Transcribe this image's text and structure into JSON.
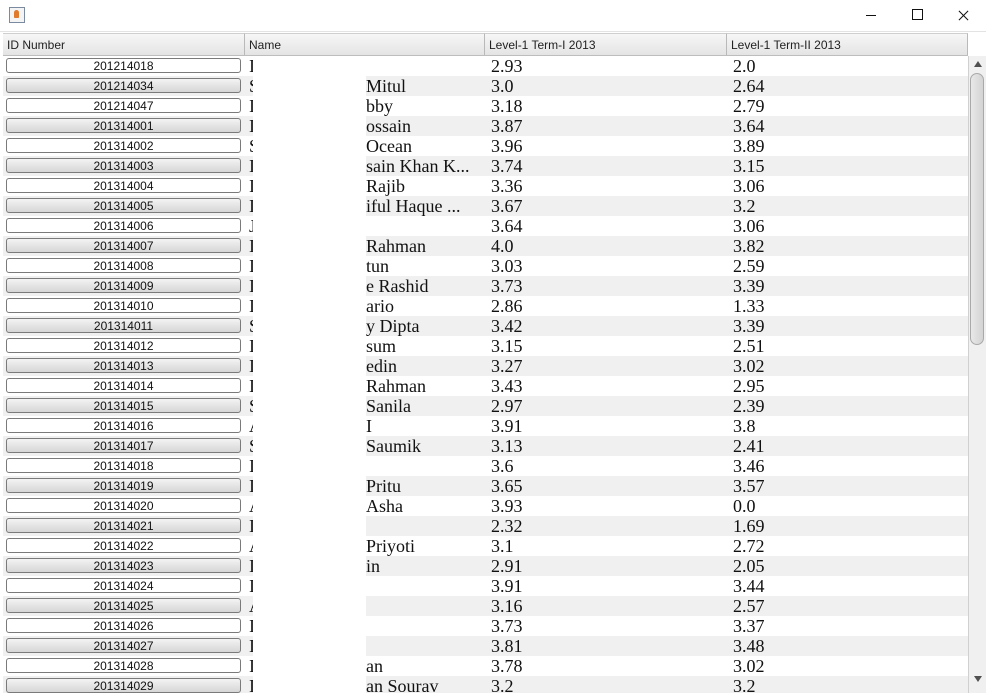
{
  "window": {
    "app_icon": "java-cup-icon",
    "controls": [
      "minimize-icon",
      "maximize-icon",
      "close-icon"
    ]
  },
  "table": {
    "headers": [
      "ID Number",
      "Name",
      "Level-1 Term-I 2013",
      "Level-1 Term-II 2013"
    ],
    "rows": [
      {
        "id": "201214018",
        "name_lead": "I",
        "name_tail": "",
        "t1": "2.93",
        "t2": "2.0"
      },
      {
        "id": "201214034",
        "name_lead": "S",
        "name_tail": "Mitul",
        "t1": "3.0",
        "t2": "2.64"
      },
      {
        "id": "201214047",
        "name_lead": "I",
        "name_tail": "bby",
        "t1": "3.18",
        "t2": "2.79"
      },
      {
        "id": "201314001",
        "name_lead": "I",
        "name_tail": "ossain",
        "t1": "3.87",
        "t2": "3.64"
      },
      {
        "id": "201314002",
        "name_lead": "S",
        "name_tail": "Ocean",
        "t1": "3.96",
        "t2": "3.89"
      },
      {
        "id": "201314003",
        "name_lead": "I",
        "name_tail": "sain Khan K...",
        "t1": "3.74",
        "t2": "3.15"
      },
      {
        "id": "201314004",
        "name_lead": "I",
        "name_tail": "Rajib",
        "t1": "3.36",
        "t2": "3.06"
      },
      {
        "id": "201314005",
        "name_lead": "I",
        "name_tail": "iful Haque ...",
        "t1": "3.67",
        "t2": "3.2"
      },
      {
        "id": "201314006",
        "name_lead": "J",
        "name_tail": "",
        "t1": "3.64",
        "t2": "3.06"
      },
      {
        "id": "201314007",
        "name_lead": "I",
        "name_tail": "Rahman",
        "t1": "4.0",
        "t2": "3.82"
      },
      {
        "id": "201314008",
        "name_lead": "I",
        "name_tail": "tun",
        "t1": "3.03",
        "t2": "2.59"
      },
      {
        "id": "201314009",
        "name_lead": "I",
        "name_tail": "e Rashid",
        "t1": "3.73",
        "t2": "3.39"
      },
      {
        "id": "201314010",
        "name_lead": "I",
        "name_tail": "ario",
        "t1": "2.86",
        "t2": "1.33"
      },
      {
        "id": "201314011",
        "name_lead": "S",
        "name_tail": "y Dipta",
        "t1": "3.42",
        "t2": "3.39"
      },
      {
        "id": "201314012",
        "name_lead": "I",
        "name_tail": "sum",
        "t1": "3.15",
        "t2": "2.51"
      },
      {
        "id": "201314013",
        "name_lead": "I",
        "name_tail": "edin",
        "t1": "3.27",
        "t2": "3.02"
      },
      {
        "id": "201314014",
        "name_lead": "I",
        "name_tail": "Rahman",
        "t1": "3.43",
        "t2": "2.95"
      },
      {
        "id": "201314015",
        "name_lead": "S",
        "name_tail": "Sanila",
        "t1": "2.97",
        "t2": "2.39"
      },
      {
        "id": "201314016",
        "name_lead": "A",
        "name_tail": "I",
        "t1": "3.91",
        "t2": "3.8"
      },
      {
        "id": "201314017",
        "name_lead": "S",
        "name_tail": "Saumik",
        "t1": "3.13",
        "t2": "2.41"
      },
      {
        "id": "201314018",
        "name_lead": "I",
        "name_tail": "",
        "t1": "3.6",
        "t2": "3.46"
      },
      {
        "id": "201314019",
        "name_lead": "I",
        "name_tail": "Pritu",
        "t1": "3.65",
        "t2": "3.57"
      },
      {
        "id": "201314020",
        "name_lead": "A",
        "name_tail": "Asha",
        "t1": "3.93",
        "t2": "0.0"
      },
      {
        "id": "201314021",
        "name_lead": "I",
        "name_tail": "",
        "t1": "2.32",
        "t2": "1.69"
      },
      {
        "id": "201314022",
        "name_lead": "A",
        "name_tail": "Priyoti",
        "t1": "3.1",
        "t2": "2.72"
      },
      {
        "id": "201314023",
        "name_lead": "I",
        "name_tail": "in",
        "t1": "2.91",
        "t2": "2.05"
      },
      {
        "id": "201314024",
        "name_lead": "I",
        "name_tail": "",
        "t1": "3.91",
        "t2": "3.44"
      },
      {
        "id": "201314025",
        "name_lead": "A",
        "name_tail": "",
        "t1": "3.16",
        "t2": "2.57"
      },
      {
        "id": "201314026",
        "name_lead": "I",
        "name_tail": "",
        "t1": "3.73",
        "t2": "3.37"
      },
      {
        "id": "201314027",
        "name_lead": "I",
        "name_tail": "",
        "t1": "3.81",
        "t2": "3.48"
      },
      {
        "id": "201314028",
        "name_lead": "I",
        "name_tail": "an",
        "t1": "3.78",
        "t2": "3.02"
      },
      {
        "id": "201314029",
        "name_lead": "I",
        "name_tail": "an Sourav",
        "t1": "3.2",
        "t2": "3.2"
      }
    ]
  },
  "scrollbar": {
    "up_icon": "arrow-up-icon",
    "down_icon": "arrow-down-icon"
  }
}
